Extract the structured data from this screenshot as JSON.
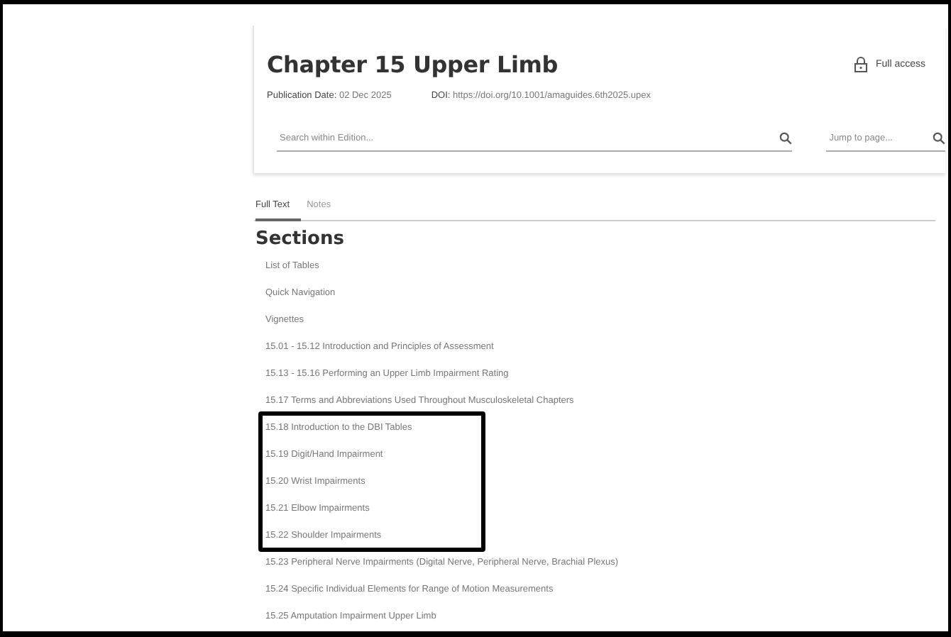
{
  "header": {
    "title": "Chapter 15 Upper Limb",
    "access": "Full access",
    "publication_label": "Publication Date:",
    "publication_date": "02 Dec 2025",
    "doi_label": "DOI:",
    "doi": "https://doi.org/10.1001/amaguides.6th2025.upex"
  },
  "search": {
    "placeholder": "Search within Edition..."
  },
  "jump": {
    "placeholder": "Jump to page..."
  },
  "tabs": [
    {
      "label": "Full Text",
      "selected": true
    },
    {
      "label": "Notes",
      "selected": false
    }
  ],
  "sections_heading": "Sections",
  "sections": [
    {
      "label": "List of Tables",
      "highlighted": false
    },
    {
      "label": "Quick Navigation",
      "highlighted": false
    },
    {
      "label": "Vignettes",
      "highlighted": false
    },
    {
      "label": "15.01 - 15.12 Introduction and Principles of Assessment",
      "highlighted": false
    },
    {
      "label": "15.13 - 15.16 Performing an Upper Limb Impairment Rating",
      "highlighted": false
    },
    {
      "label": "15.17 Terms and Abbreviations Used Throughout Musculoskeletal Chapters",
      "highlighted": false
    },
    {
      "label": "15.18 Introduction to the DBI Tables",
      "highlighted": true
    },
    {
      "label": "15.19 Digit/Hand Impairment",
      "highlighted": true
    },
    {
      "label": "15.20 Wrist Impairments",
      "highlighted": true
    },
    {
      "label": "15.21 Elbow Impairments",
      "highlighted": true
    },
    {
      "label": "15.22 Shoulder Impairments",
      "highlighted": true
    },
    {
      "label": "15.23 Peripheral Nerve Impairments (Digital Nerve, Peripheral Nerve, Brachial Plexus)",
      "highlighted": false
    },
    {
      "label": "15.24 Specific Individual Elements for Range of Motion Measurements",
      "highlighted": false
    },
    {
      "label": "15.25 Amputation Impairment Upper Limb",
      "highlighted": false
    }
  ]
}
